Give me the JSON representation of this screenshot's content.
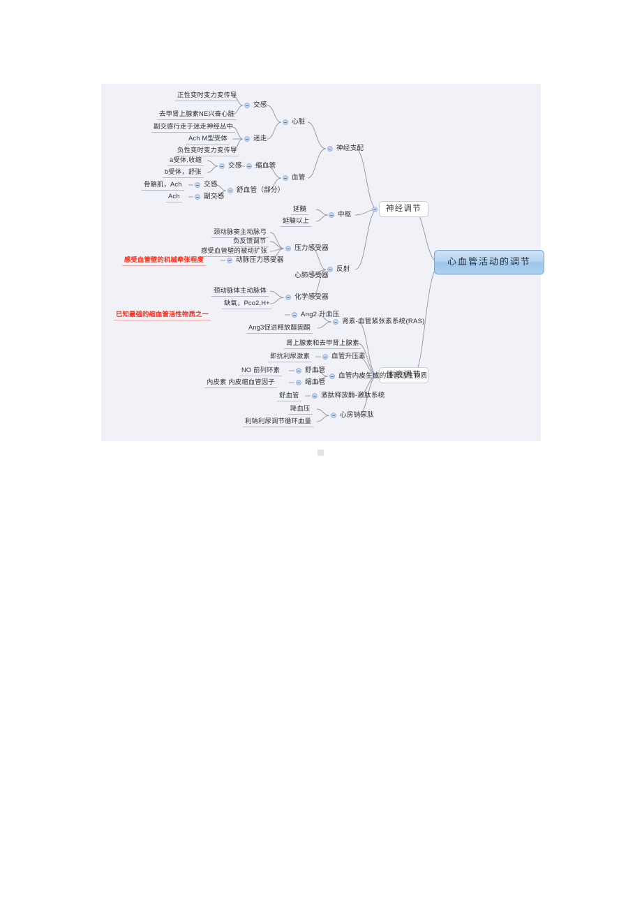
{
  "document": {
    "background": "#ffffff",
    "canvas_background": "#f1f2f7"
  },
  "colors": {
    "root_fill_top": "#cfe4f7",
    "root_fill_bottom": "#9cc6eb",
    "root_border": "#7ba7d0",
    "node_border": "#c9ccd6",
    "leaf_underline": "#b9bcc8",
    "branch_line": "#8f939e",
    "highlight_red": "#ff2d1a",
    "toggle_fill": "#c5d8ef"
  },
  "root": {
    "label": "心血管活动的调节"
  },
  "level1": {
    "neural": "神经调节",
    "humoral": "体液调节"
  },
  "level2": {
    "innervation": "神经支配",
    "center": "中枢",
    "reflex": "反射"
  },
  "neural": {
    "innervation": {
      "heart": {
        "label": "心脏",
        "sympathetic": {
          "label": "交感",
          "items": [
            "正性变时变力变传导",
            "去甲肾上腺素NE兴奋心脏"
          ]
        },
        "vagus": {
          "label": "迷走",
          "items": [
            "副交感行走于迷走神经丛中",
            "Ach M型受体",
            "负性变时变力变传导"
          ]
        }
      },
      "vessel": {
        "label": "血管",
        "vasoconstriction": {
          "label": "缩血管",
          "sympathetic": "交感",
          "items": [
            "a受体,收缩",
            "b受体，舒张"
          ]
        },
        "vasodilation": {
          "label": "舒血管（部分）",
          "sympathetic_label": "交感",
          "sympathetic_item": "骨骼肌，Ach",
          "parasympathetic_label": "副交感",
          "parasympathetic_item": "Ach"
        }
      }
    },
    "center": {
      "label": "中枢",
      "items": [
        "延髓",
        "延髓以上"
      ]
    },
    "reflex": {
      "label": "反射",
      "baroreceptor": {
        "label": "压力感受器",
        "items": [
          "颈动脉窦主动脉弓",
          "负反馈调节",
          "感受血管壁的被动扩张"
        ],
        "arterial": {
          "label": "动脉压力感受器",
          "note": "感受血管壁的机械牵张程度",
          "note_color": "#ff2d1a"
        }
      },
      "cardiopulmonary": {
        "label": "心肺感受器"
      },
      "chemoreceptor": {
        "label": "化学感受器",
        "items": [
          "颈动脉体主动脉体",
          "缺氧，Pco2,H+"
        ]
      }
    }
  },
  "humoral": {
    "ras": {
      "label": "肾素-血管紧张素系统(RAS)",
      "ang2": {
        "label": "Ang2 升血压",
        "note": "已知最强的缩血管活性物质之一",
        "note_color": "#ff2d1a"
      },
      "ang3": "Ang3促进释放醛固酮"
    },
    "catecholamines": {
      "label": "肾上腺素和去甲肾上腺素"
    },
    "vasopressin": {
      "label": "血管升压素",
      "note": "即抗利尿激素"
    },
    "endothelium": {
      "label": "血管内皮生成的血管活性物质",
      "vasodilator": {
        "label": "舒血管",
        "items": "NO 前列环素"
      },
      "vasoconstrictor": {
        "label": "缩血管",
        "items": "内皮素 内皮缩血管因子"
      }
    },
    "kallikrein": {
      "label": "激肽释放酶-激肽系统",
      "effect": "舒血管"
    },
    "anp": {
      "label": "心房钠尿肽",
      "items": [
        "降血压",
        "利钠利尿调节循环血量"
      ]
    }
  }
}
